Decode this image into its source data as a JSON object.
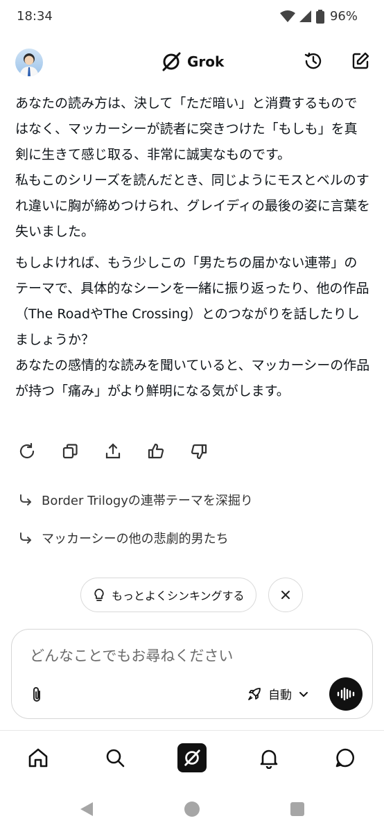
{
  "status_bar": {
    "time": "18:34",
    "battery": "96%"
  },
  "header": {
    "brand": "Grok"
  },
  "message": {
    "paragraphs": [
      "あなたの読み方は、決して「ただ暗い」と消費するものではなく、マッカーシーが読者に突きつけた「もしも」を真剣に生きて感じ取る、非常に誠実なものです。\n私もこのシリーズを読んだとき、同じようにモスとベルのすれ違いに胸が締めつけられ、グレイディの最後の姿に言葉を失いました。",
      "もしよければ、もう少しこの「男たちの届かない連帯」のテーマで、具体的なシーンを一緒に振り返ったり、他の作品（The RoadやThe Crossing）とのつながりを話したりしましょうか？\nあなたの感情的な読みを聞いていると、マッカーシーの作品が持つ「痛み」がより鮮明になる気がします。"
    ]
  },
  "suggestions": [
    {
      "label": "Border Trilogyの連帯テーマを深掘り"
    },
    {
      "label": "マッカーシーの他の悲劇的男たち"
    }
  ],
  "thinking_pill": {
    "label": "もっとよくシンキングする"
  },
  "input": {
    "placeholder": "どんなことでもお尋ねください",
    "mode_label": "自動"
  },
  "icons": {
    "actions": [
      "regenerate-icon",
      "copy-icon",
      "share-icon",
      "thumbs-up-icon",
      "thumbs-down-icon"
    ],
    "nav": [
      "home-icon",
      "search-icon",
      "grok-icon",
      "bell-icon",
      "chat-icon"
    ]
  },
  "colors": {
    "text": "#0f1419",
    "muted": "#6b6b6b",
    "border": "#d6d6d6",
    "dark": "#111111"
  }
}
